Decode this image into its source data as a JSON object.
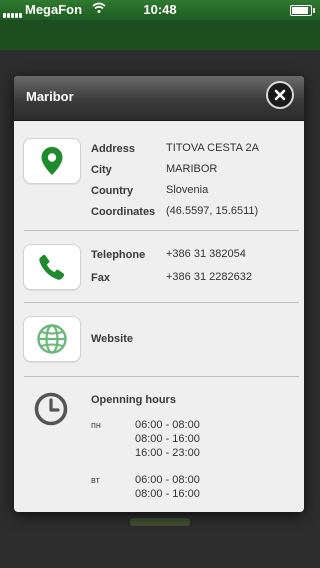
{
  "status_bar": {
    "carrier": "MegaFon",
    "time": "10:48"
  },
  "modal": {
    "title": "Maribor"
  },
  "address": {
    "labels": {
      "address": "Address",
      "city": "City",
      "country": "Country",
      "coordinates": "Coordinates"
    },
    "values": {
      "address": "TITOVA CESTA 2A",
      "city": "MARIBOR",
      "country": "Slovenia",
      "coordinates": "(46.5597, 15.6511)"
    },
    "icon": "map-pin-icon"
  },
  "contact": {
    "labels": {
      "telephone": "Telephone",
      "fax": "Fax"
    },
    "values": {
      "telephone": "+386 31 382054",
      "fax": "+386 31 2282632"
    },
    "icon": "phone-icon"
  },
  "website": {
    "label": "Website",
    "icon": "globe-icon"
  },
  "opening_hours": {
    "label": "Openning hours",
    "icon": "clock-icon",
    "days": [
      {
        "day": "пн",
        "hours": [
          "06:00 - 08:00",
          "08:00 - 16:00",
          "16:00 - 23:00"
        ]
      },
      {
        "day": "вт",
        "hours": [
          "06:00 - 08:00",
          "08:00 - 16:00"
        ]
      }
    ]
  },
  "colors": {
    "accent_green": "#1f8a2e",
    "globe_green": "#6ab77a",
    "clock_grey": "#555555"
  }
}
